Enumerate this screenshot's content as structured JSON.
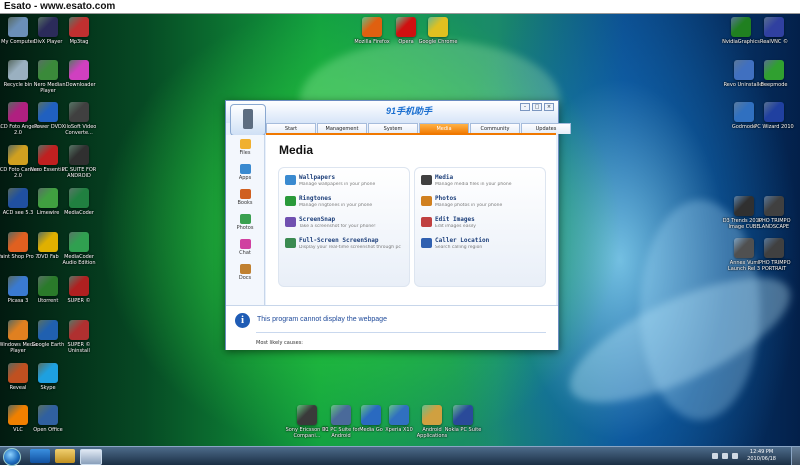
{
  "screen_title": "Esato - www.esato.com",
  "desktop_icons_left": [
    {
      "label": "My Computer",
      "color": "#6b8fb8"
    },
    {
      "label": "DivX Player",
      "color": "#2b2b5a"
    },
    {
      "label": "Mp3tag",
      "color": "#c03030"
    },
    {
      "label": "Recycle bin",
      "color": "#9ab0c0"
    },
    {
      "label": "Nero Media Player",
      "color": "#3a8a3a"
    },
    {
      "label": "nDownloader",
      "color": "#d040c0"
    },
    {
      "label": "ACD Foto Angelo 2.0",
      "color": "#b02080"
    },
    {
      "label": "Power DVD",
      "color": "#2060c0"
    },
    {
      "label": "XiloSoft Video Converte...",
      "color": "#404040"
    },
    {
      "label": "ACD Foto Canvas 2.0",
      "color": "#d0a020"
    },
    {
      "label": "Nero Essential",
      "color": "#c02020"
    },
    {
      "label": "PC SUITE FOR ANDROID",
      "color": "#303030"
    },
    {
      "label": "ACD see 5.3",
      "color": "#2050a0"
    },
    {
      "label": "Limewire",
      "color": "#40a040"
    },
    {
      "label": "MediaCoder",
      "color": "#208040"
    },
    {
      "label": "Paint Shop Pro 7",
      "color": "#e06020"
    },
    {
      "label": "DVD Fab",
      "color": "#e0b000"
    },
    {
      "label": "MediaCoder Audio Edition",
      "color": "#30a050"
    },
    {
      "label": "Picasa 3",
      "color": "#3a7ad0"
    },
    {
      "label": "Utorrent",
      "color": "#2a7a2a"
    },
    {
      "label": "SUPER ©",
      "color": "#b02020"
    },
    {
      "label": "Windows Media Player",
      "color": "#e08020"
    },
    {
      "label": "Google Earth",
      "color": "#2060b0"
    },
    {
      "label": "SUPER © Uninstall",
      "color": "#b03030"
    },
    {
      "label": "Reveal",
      "color": "#c05020"
    },
    {
      "label": "Skype",
      "color": "#1ea0e0"
    },
    {
      "label": "VLC",
      "color": "#f08000"
    },
    {
      "label": "Open Office",
      "color": "#3060a0"
    }
  ],
  "desktop_icons_top": [
    {
      "label": "Mozilla Firefox",
      "color": "#e06010"
    },
    {
      "label": "Opera",
      "color": "#d01010"
    },
    {
      "label": "Google Chrome",
      "color": "#e0c020"
    }
  ],
  "desktop_icons_right": [
    {
      "label": "NvidiaGraphics",
      "color": "#208020"
    },
    {
      "label": "RealVNC ©",
      "color": "#3040a0"
    },
    {
      "label": "Revo Uninstaller",
      "color": "#4070c0"
    },
    {
      "label": "Beepmode",
      "color": "#30a030"
    },
    {
      "label": "Godmode",
      "color": "#3070c0"
    },
    {
      "label": "PC Wizard 2010",
      "color": "#2040a0"
    },
    {
      "label": "D3 Trends 2010 - Image CUBE",
      "color": "#303030"
    },
    {
      "label": "IPHO TRIMPO LANDSCAPE",
      "color": "#404040"
    },
    {
      "label": "Annex Vum Launch Rel 3",
      "color": "#505050"
    },
    {
      "label": "IPHO TRIMPO PORTRAIT",
      "color": "#404040"
    }
  ],
  "desktop_icons_bottom": [
    {
      "label": "Sony Ericsson PC Compani...",
      "color": "#3a3a3a"
    },
    {
      "label": "91 PC Suite for Android",
      "color": "#4a6a9a"
    },
    {
      "label": "Media Go",
      "color": "#2a6ac0"
    },
    {
      "label": "Xperia X10",
      "color": "#3070c0"
    },
    {
      "label": "Android Applications",
      "color": "#d0a040"
    },
    {
      "label": "Nokia PC Suite",
      "color": "#2a4a9a"
    }
  ],
  "app": {
    "brand": "91手机助手",
    "tabs": [
      "Start",
      "Management",
      "System",
      "Media",
      "Community",
      "Updates"
    ],
    "active_tab": "Media",
    "sidebar": [
      "Files",
      "Apps",
      "Books",
      "Photos",
      "Chat",
      "Docs"
    ],
    "heading": "Media",
    "left_features": [
      {
        "title": "Wallpapers",
        "desc": "Manage wallpapers in your phone",
        "color": "#3a8ad0"
      },
      {
        "title": "Ringtones",
        "desc": "Manage ringtones in your phone",
        "color": "#2a9a3a"
      },
      {
        "title": "ScreenSnap",
        "desc": "Take a screenshot for your phone!",
        "color": "#7050b0"
      },
      {
        "title": "Full-Screen ScreenSnap",
        "desc": "Display your real-time screenshot through pc",
        "color": "#3a8a50"
      }
    ],
    "right_features": [
      {
        "title": "Media",
        "desc": "Manage media files in your phone",
        "color": "#404040"
      },
      {
        "title": "Photos",
        "desc": "Manage photos in your phone",
        "color": "#d08020"
      },
      {
        "title": "Edit Images",
        "desc": "Edit images easily",
        "color": "#c04040"
      },
      {
        "title": "Caller Location",
        "desc": "Search calling region",
        "color": "#3060b0"
      }
    ],
    "error_message": "This program cannot display the webpage",
    "error_cause": "Most likely causes:"
  },
  "taskbar": {
    "time": "12:49 PM",
    "date": "2010/06/18"
  }
}
